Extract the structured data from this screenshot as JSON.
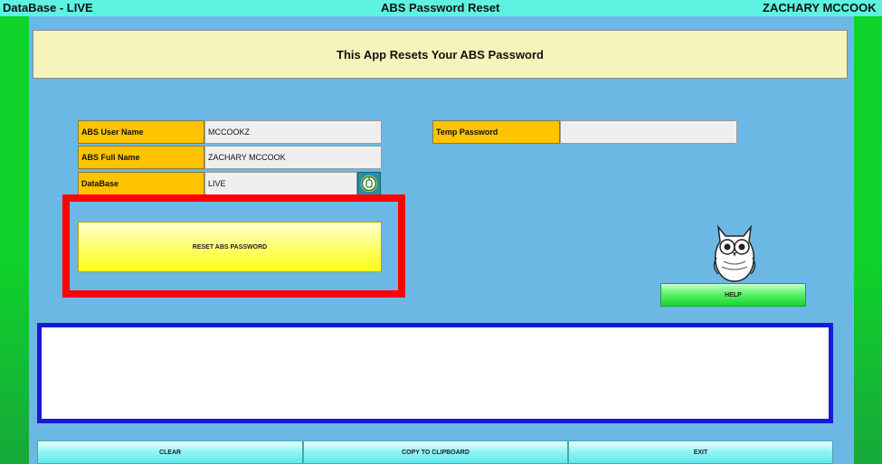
{
  "titlebar": {
    "database": "DataBase - LIVE",
    "app_title": "ABS Password Reset",
    "user": "ZACHARY MCCOOK"
  },
  "banner": {
    "text": "This App Resets Your ABS Password"
  },
  "fields": {
    "user_name": {
      "label": "ABS User Name",
      "value": "MCCOOKZ"
    },
    "full_name": {
      "label": "ABS Full Name",
      "value": "ZACHARY MCCOOK"
    },
    "database": {
      "label": "DataBase",
      "value": "LIVE"
    },
    "temp_password": {
      "label": "Temp Password",
      "value": ""
    }
  },
  "buttons": {
    "reset": "RESET ABS PASSWORD",
    "help": "HELP",
    "clear": "CLEAR",
    "copy": "COPY TO CLIPBOARD",
    "exit": "EXIT"
  },
  "message": {
    "text": ""
  },
  "icons": {
    "database_icon": "database-connect-icon",
    "mascot": "owl-icon"
  },
  "colors": {
    "titlebar": "#5ef2e2",
    "background": "#6cb8e4",
    "label": "#ffc300",
    "highlight": "#ff0000",
    "message_border": "#1a1adb"
  }
}
